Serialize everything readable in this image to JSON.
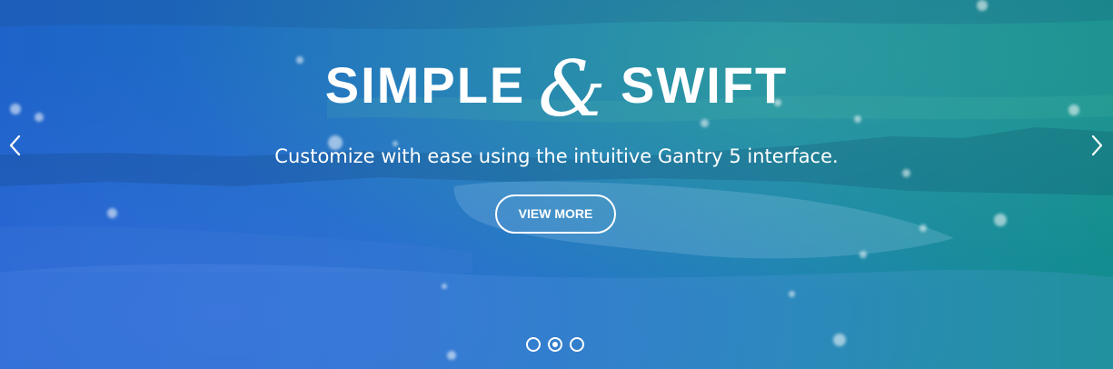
{
  "slide": {
    "headline_left": "SIMPLE",
    "headline_amp": "&",
    "headline_right": "SWIFT",
    "subtitle": "Customize with ease using the intuitive Gantry 5 interface.",
    "cta_label": "VIEW MORE"
  },
  "carousel": {
    "prev_icon": "chevron-left-icon",
    "next_icon": "chevron-right-icon",
    "slide_count": 3,
    "active_index": 1
  },
  "colors": {
    "gradient_left": "#1e63c9",
    "gradient_right": "#138d8f",
    "text": "#ffffff"
  }
}
